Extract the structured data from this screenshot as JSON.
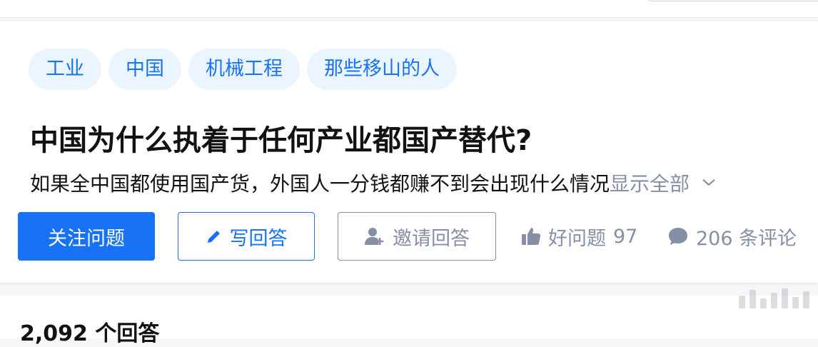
{
  "tags": [
    "工业",
    "中国",
    "机械工程",
    "那些移山的人"
  ],
  "question": {
    "title": "中国为什么执着于任何产业都国产替代?",
    "excerpt": "如果全中国都使用国产货，外国人一分钱都赚不到会出现什么情况",
    "show_all_label": "显示全部"
  },
  "actions": {
    "follow_label": "关注问题",
    "write_label": "写回答",
    "invite_label": "邀请回答",
    "good_question_label": "好问题",
    "good_question_count": "97",
    "comments_label": "206 条评论"
  },
  "answers": {
    "count_label": "2,092 个回答"
  },
  "colors": {
    "accent": "#1772f6",
    "tag_bg": "#ebf5ff",
    "muted": "#8590a6",
    "text": "#121212"
  },
  "icons": {
    "write": "pencil-icon",
    "invite": "add-user-icon",
    "like": "thumbs-up-icon",
    "comment": "comment-bubble-icon",
    "expand": "chevron-down-icon"
  }
}
